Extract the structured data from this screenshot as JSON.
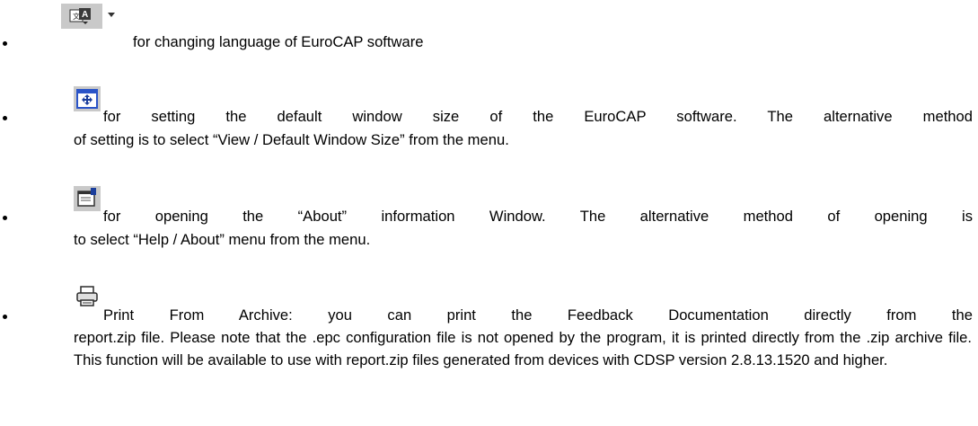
{
  "items": [
    {
      "icon": "language-flag-icon",
      "line1": "for changing language of EuroCAP software",
      "rest": ""
    },
    {
      "icon": "default-window-size-icon",
      "line1": "for setting the default window size of the EuroCAP software. The alternative method",
      "rest": "of setting is to select “View / Default Window Size” from the menu."
    },
    {
      "icon": "about-window-icon",
      "line1": "for opening the “About” information Window. The alternative method of opening is",
      "rest": "to select “Help / About” menu from the menu."
    },
    {
      "icon": "printer-icon",
      "line1": "Print From Archive: you can print the Feedback Documentation directly from the",
      "rest": "report.zip file. Please note that the .epc configuration file is not opened by the program, it is printed directly from the .zip archive file. This function will be available to use with report.zip files generated from devices with CDSP version 2.8.13.1520 and higher."
    }
  ]
}
